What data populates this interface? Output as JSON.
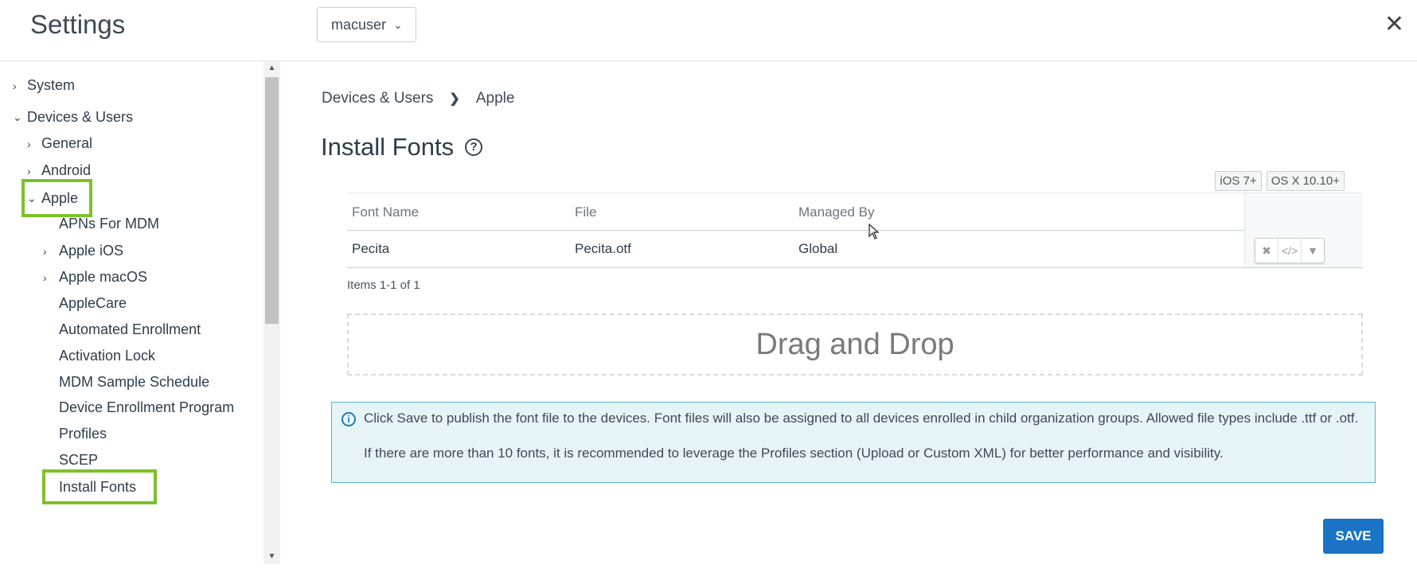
{
  "header": {
    "title": "Settings",
    "user_dropdown": "macuser",
    "close_icon": "close-icon"
  },
  "sidebar": {
    "items": [
      {
        "label": "System",
        "expanded": false
      },
      {
        "label": "Devices & Users",
        "expanded": true
      },
      {
        "label": "General",
        "expanded": false
      },
      {
        "label": "Android",
        "expanded": false
      },
      {
        "label": "Apple",
        "expanded": true,
        "highlighted": true
      },
      {
        "label": "APNs For MDM"
      },
      {
        "label": "Apple iOS",
        "expanded": false
      },
      {
        "label": "Apple macOS",
        "expanded": false
      },
      {
        "label": "AppleCare"
      },
      {
        "label": "Automated Enrollment"
      },
      {
        "label": "Activation Lock"
      },
      {
        "label": "MDM Sample Schedule"
      },
      {
        "label": "Device Enrollment Program"
      },
      {
        "label": "Profiles"
      },
      {
        "label": "SCEP"
      },
      {
        "label": "Install Fonts",
        "highlighted": true
      }
    ]
  },
  "breadcrumb": {
    "level1": "Devices & Users",
    "level2": "Apple"
  },
  "page": {
    "title": "Install Fonts",
    "badges": [
      "iOS 7+",
      "OS X 10.10+"
    ]
  },
  "table": {
    "columns": [
      "Font Name",
      "File",
      "Managed By"
    ],
    "rows": [
      {
        "font_name": "Pecita",
        "file": "Pecita.otf",
        "managed_by": "Global"
      }
    ],
    "items_count": "Items 1-1 of 1"
  },
  "dropzone": {
    "label": "Drag and Drop"
  },
  "info": {
    "line1": "Click Save to publish the font file to the devices. Font files will also be assigned to all devices enrolled in child organization groups. Allowed file types include .ttf or .otf.",
    "line2": "If there are more than 10 fonts, it is recommended to leverage the Profiles section (Upload or Custom XML) for better performance and visibility."
  },
  "actions": {
    "save_label": "SAVE"
  },
  "colors": {
    "highlight": "#7dc12a",
    "save_button": "#1a73c5",
    "info_background": "#e6f4f8",
    "info_border": "#5ab4d3"
  }
}
